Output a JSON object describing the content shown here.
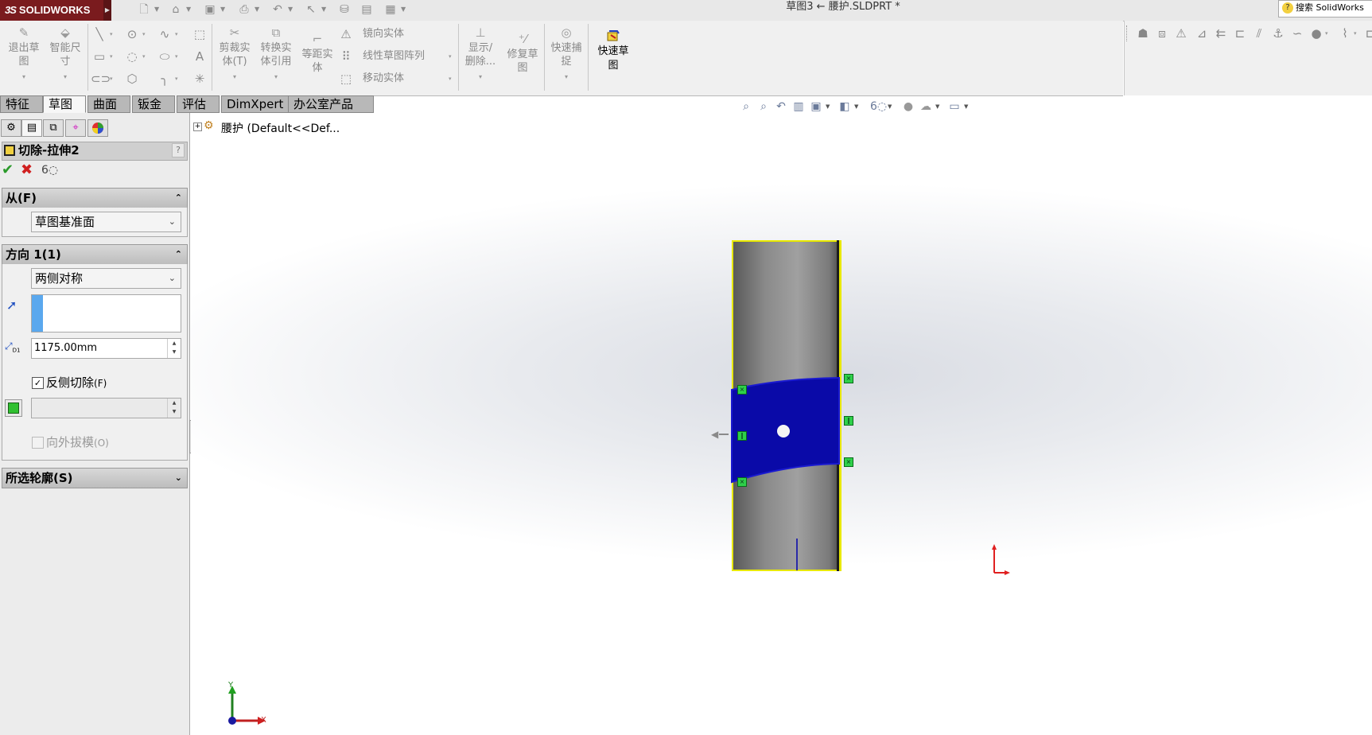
{
  "app": {
    "logo_text": "SOLIDWORKS",
    "document_title": "草图3 ← 腰护.SLDPRT *",
    "search_label": "搜索 SolidWorks",
    "search_help_glyph": "?"
  },
  "quick_access": [
    {
      "icon": "new-document-icon",
      "glyph": "🗋"
    },
    {
      "icon": "open-icon",
      "glyph": "📂"
    },
    {
      "icon": "save-icon",
      "glyph": "💾"
    },
    {
      "icon": "print-icon",
      "glyph": "🖶"
    },
    {
      "icon": "undo-icon",
      "glyph": "↶"
    },
    {
      "icon": "select-icon",
      "glyph": "↖"
    },
    {
      "icon": "rebuild-icon",
      "glyph": "⛁"
    },
    {
      "icon": "file-properties-icon",
      "glyph": "▤"
    },
    {
      "icon": "options-icon",
      "glyph": "▦"
    }
  ],
  "commands": {
    "exit_sketch": "退出草\n图",
    "smart_dimension": "智能尺\n寸",
    "trim_entities": "剪裁实\n体(T)",
    "convert_entities": "转换实\n体引用",
    "offset_entities": "等距实\n体",
    "mirror_entities": "镜向实体",
    "linear_pattern": "线性草图阵列",
    "move_entities": "移动实体",
    "display_delete": "显示/\n删除...",
    "repair_sketch": "修复草\n图",
    "quick_snaps": "快速捕\n捉",
    "rapid_sketch": "快速草\n图"
  },
  "tabs": [
    {
      "label": "特征",
      "active": false
    },
    {
      "label": "草图",
      "active": true
    },
    {
      "label": "曲面",
      "active": false
    },
    {
      "label": "钣金",
      "active": false
    },
    {
      "label": "评估",
      "active": false
    },
    {
      "label": "DimXpert",
      "active": false
    },
    {
      "label": "办公室产品",
      "active": false
    }
  ],
  "property_manager": {
    "title": "切除-拉伸2",
    "help": "?",
    "from_section": {
      "title": "从(F)",
      "value": "草图基准面"
    },
    "direction1_section": {
      "title": "方向 1(1)",
      "end_condition": "两侧对称",
      "depth": "1175.00mm",
      "flip_side_label": "反侧切除",
      "flip_side_suffix": "(F)",
      "flip_side_checked": true,
      "draft_outward_label": "向外拔模",
      "draft_outward_suffix": "(O)",
      "draft_outward_checked": false,
      "draft_outward_enabled": false
    },
    "selected_contours_section": {
      "title": "所选轮廓(S)"
    }
  },
  "tree": {
    "root_label": "腰护  (Default<<Def..."
  },
  "triad": {
    "x_label": "X",
    "y_label": "Y"
  },
  "colors": {
    "logo_bg": "#7a1b1e",
    "part_edge": "#e8e800",
    "sketch_region": "#0a0aa8",
    "handle_green": "#2ed04a",
    "origin_red": "#e02020"
  }
}
